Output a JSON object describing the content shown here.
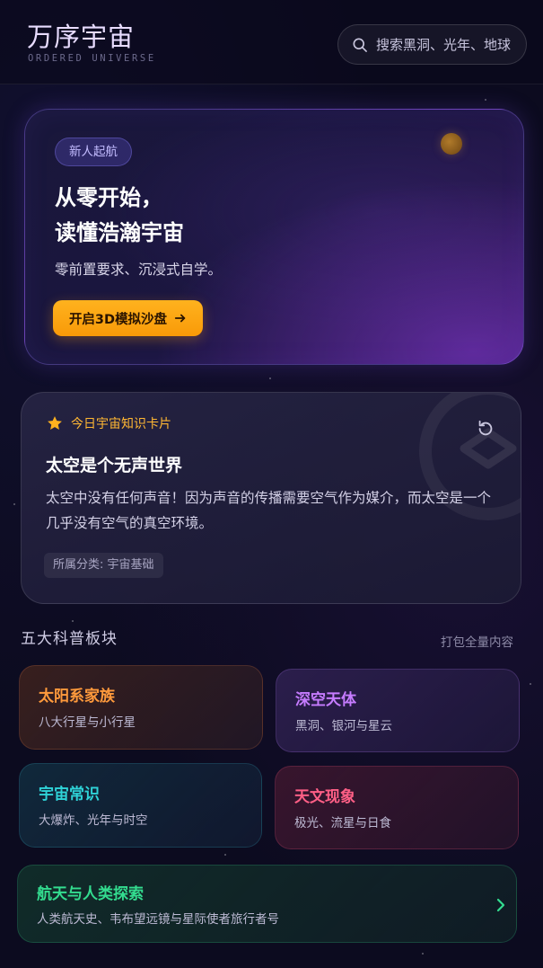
{
  "header": {
    "title": "万序宇宙",
    "subtitle": "ORDERED UNIVERSE",
    "search_placeholder": "搜索黑洞、光年、地球"
  },
  "hero": {
    "badge": "新人起航",
    "title_line1": "从零开始，",
    "title_line2": "读懂浩瀚宇宙",
    "description": "零前置要求、沉浸式自学。",
    "button_label": "开启3D模拟沙盘",
    "icons": {
      "button": "arrow-right-icon",
      "planet": "planet-icon"
    }
  },
  "knowledge_card": {
    "label": "今日宇宙知识卡片",
    "title": "太空是个无声世界",
    "body": "太空中没有任何声音！因为声音的传播需要空气作为媒介，而太空是一个几乎没有空气的真空环境。",
    "category_tag": "所属分类: 宇宙基础",
    "icons": {
      "label": "star-icon",
      "action": "refresh-icon"
    }
  },
  "section": {
    "title": "五大科普板块",
    "link": "打包全量内容"
  },
  "categories": [
    {
      "title": "太阳系家族",
      "subtitle": "八大行星与小行星",
      "color": "#ff9a3c"
    },
    {
      "title": "深空天体",
      "subtitle": "黑洞、银河与星云",
      "color": "#c67cff"
    },
    {
      "title": "宇宙常识",
      "subtitle": "大爆炸、光年与时空",
      "color": "#2fd3d8"
    },
    {
      "title": "天文现象",
      "subtitle": "极光、流星与日食",
      "color": "#ff5f86"
    },
    {
      "title": "航天与人类探索",
      "subtitle": "人类航天史、韦布望远镜与星际使者旅行者号",
      "color": "#33dc8f"
    }
  ],
  "colors": {
    "background": "#0c0b1f",
    "accent": "#ffb21e",
    "brand": "#e8dcff"
  }
}
